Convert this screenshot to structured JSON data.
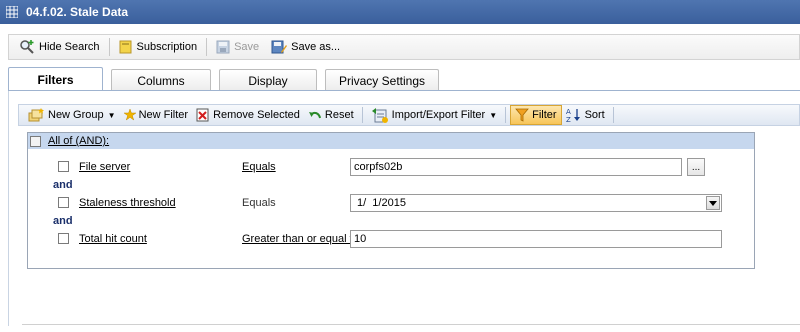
{
  "window": {
    "title": "04.f.02. Stale Data"
  },
  "toolbar": {
    "hide_search": "Hide Search",
    "subscription": "Subscription",
    "save": "Save",
    "save_as": "Save as..."
  },
  "tabs": [
    {
      "label": "Filters",
      "active": true
    },
    {
      "label": "Columns",
      "active": false
    },
    {
      "label": "Display",
      "active": false
    },
    {
      "label": "Privacy Settings",
      "active": false
    }
  ],
  "filter_toolbar": {
    "new_group": "New Group",
    "new_filter": "New Filter",
    "remove_selected": "Remove Selected",
    "reset": "Reset",
    "import_export": "Import/Export Filter",
    "filter": "Filter",
    "sort": "Sort"
  },
  "group": {
    "label": "All of (AND):"
  },
  "conjunction": "and",
  "filters": [
    {
      "field": "File server",
      "operator": "Equals",
      "value": "corpfs02b",
      "ellipsis": "..."
    },
    {
      "field": "Staleness threshold",
      "operator": "Equals",
      "value": "1/  1/2015"
    },
    {
      "field": "Total hit count",
      "operator": "Greater than or equal to",
      "value": "10"
    }
  ],
  "colors": {
    "title_bar": "#3f66a4",
    "group_header": "#c6d7ee",
    "active_filter_button": "#f7c55a",
    "conjunction_text": "#1a2f6a"
  }
}
